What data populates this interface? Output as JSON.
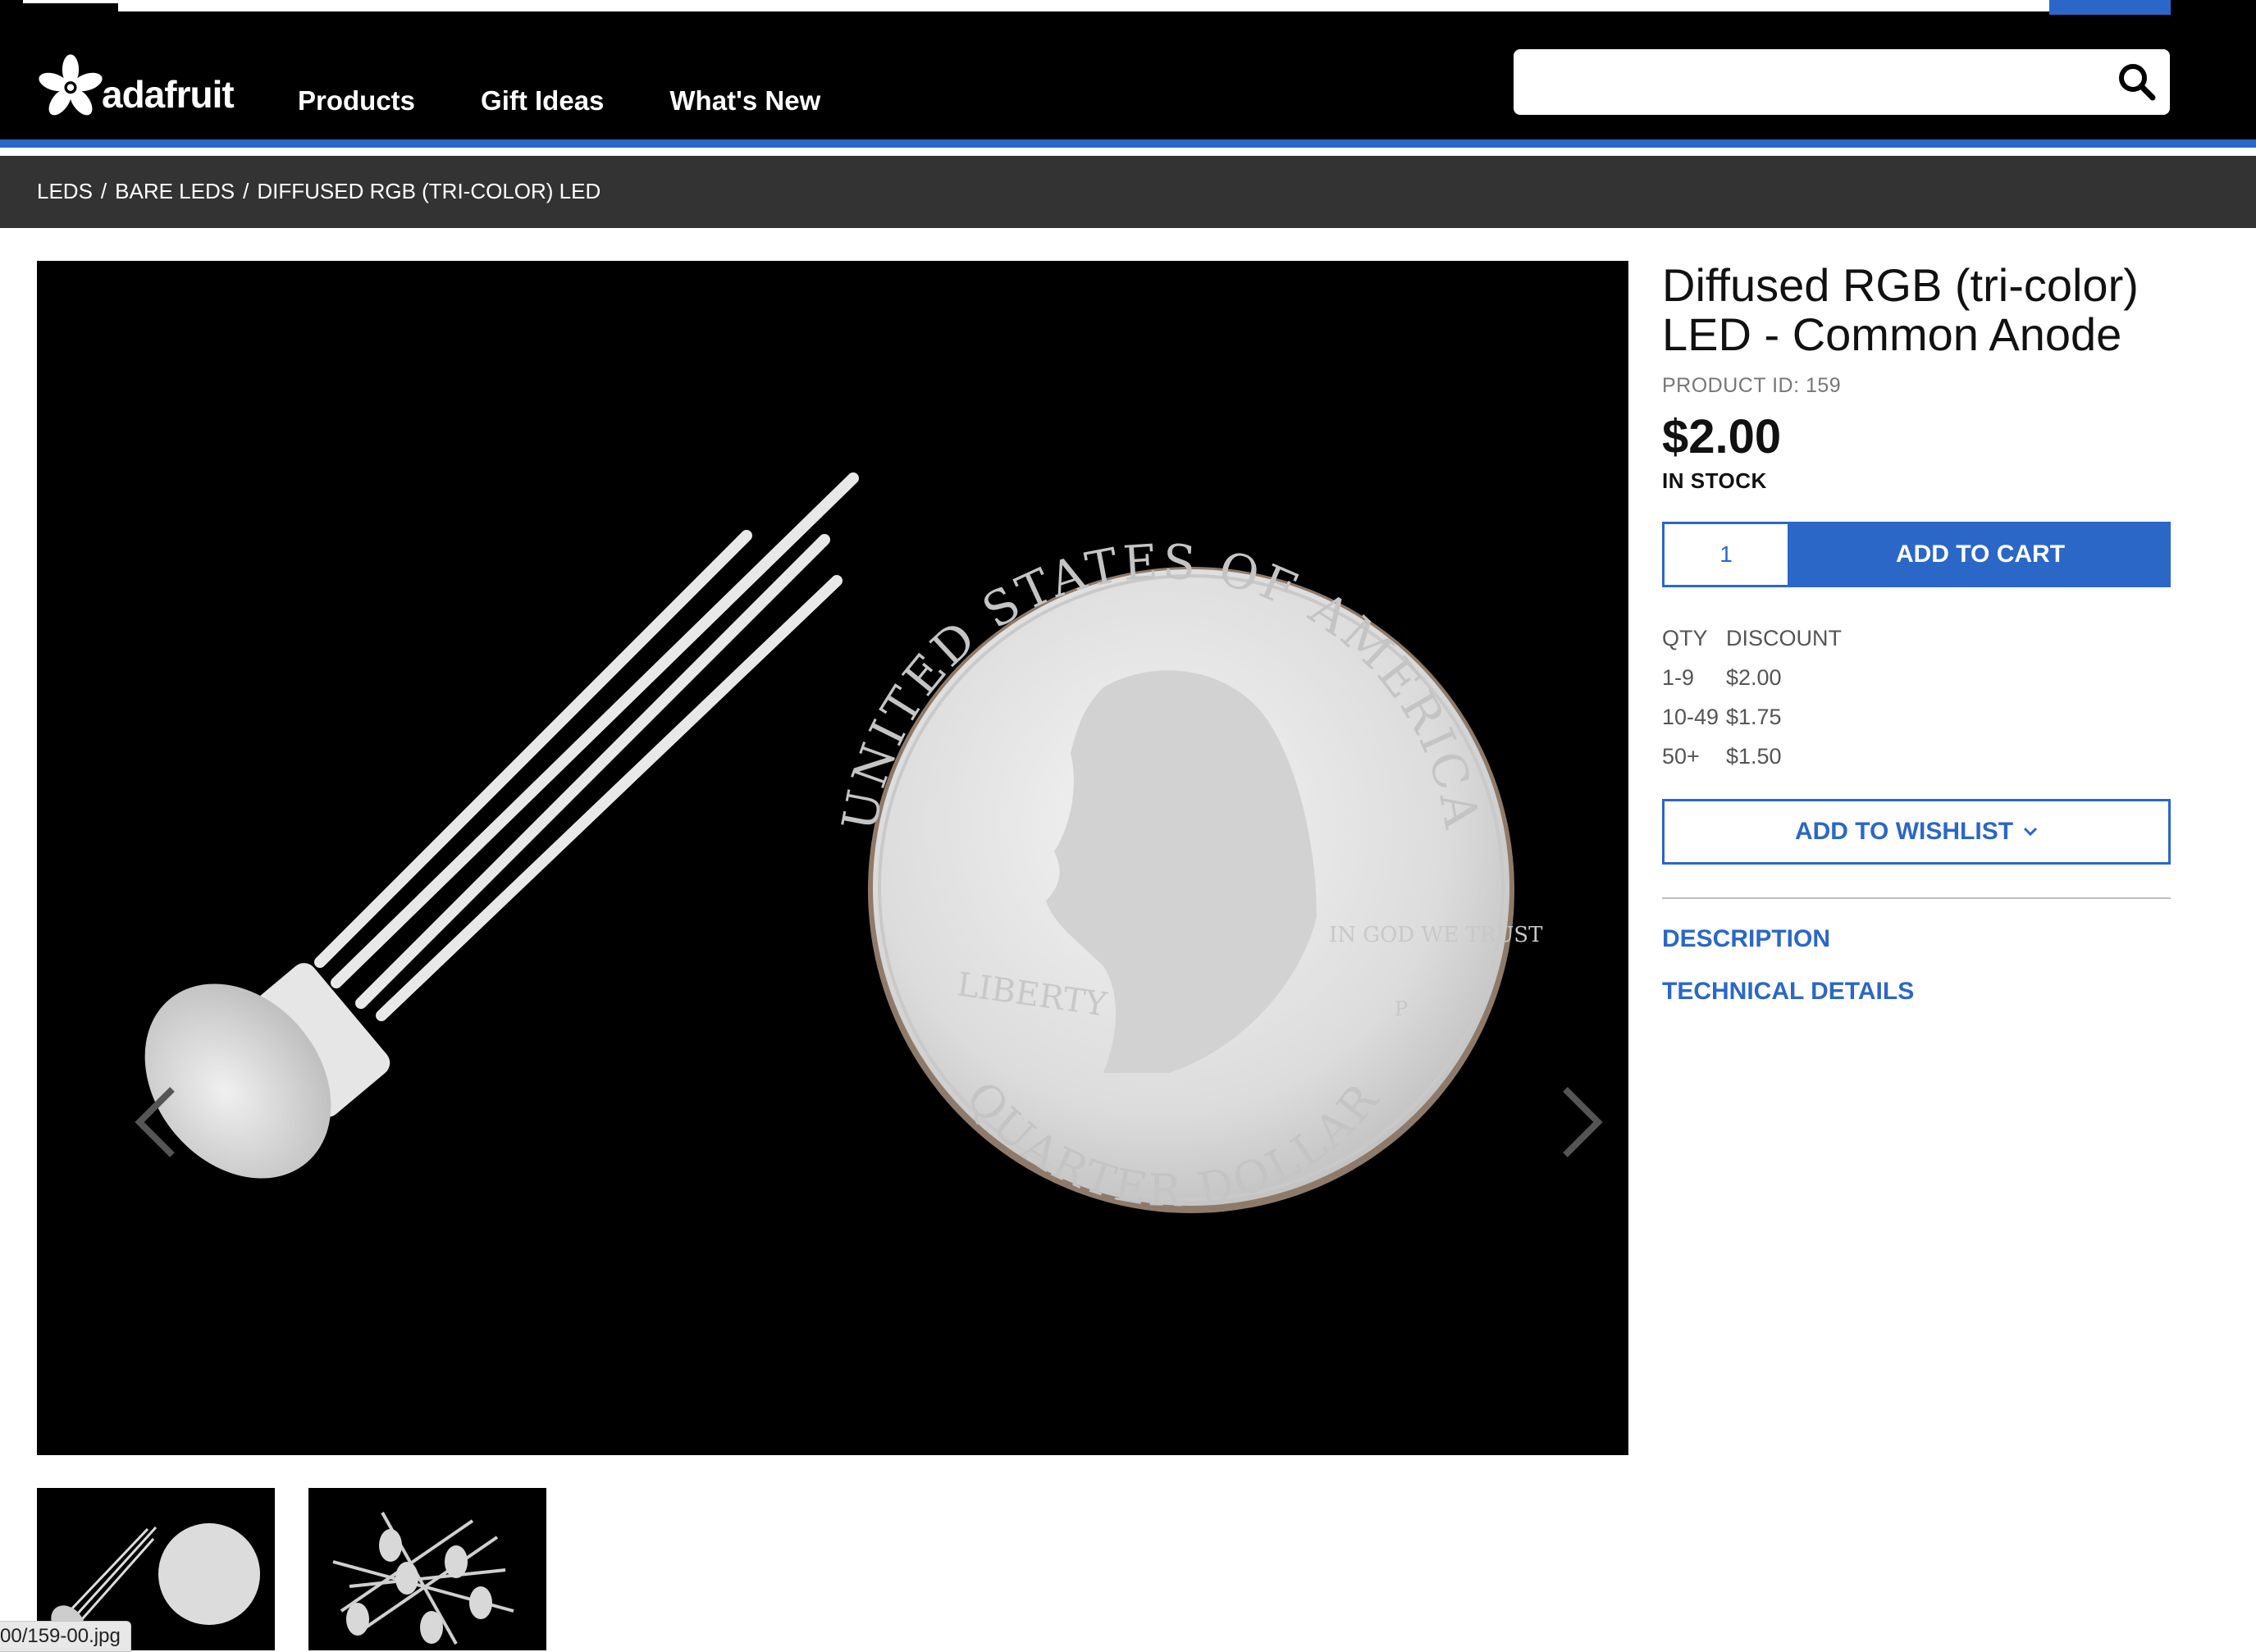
{
  "header": {
    "logo_text": "adafruit",
    "nav": [
      "Products",
      "Gift Ideas",
      "What's New"
    ],
    "search": {
      "value": "",
      "placeholder": ""
    }
  },
  "breadcrumb": [
    "LEDS",
    "BARE LEDS",
    "DIFFUSED RGB (TRI-COLOR) LED"
  ],
  "breadcrumb_separator": "/",
  "product": {
    "title": "Diffused RGB (tri-color) LED - Common Anode",
    "product_id": "PRODUCT ID: 159",
    "price": "$2.00",
    "stock": "IN STOCK",
    "quantity": "1",
    "add_to_cart": "ADD TO CART",
    "discount_headers": [
      "QTY",
      "DISCOUNT"
    ],
    "discounts": [
      {
        "qty": "1-9",
        "price": "$2.00"
      },
      {
        "qty": "10-49",
        "price": "$1.75"
      },
      {
        "qty": "50+",
        "price": "$1.50"
      }
    ],
    "add_to_wishlist": "ADD TO WISHLIST",
    "links": [
      "DESCRIPTION",
      "TECHNICAL DETAILS"
    ]
  },
  "gallery": {
    "coin_text_top": "UNITED STATES OF AMERICA",
    "coin_text_left": "LIBERTY",
    "coin_text_right": "IN GOD WE TRUST",
    "coin_text_bottom": "QUARTER DOLLAR",
    "mint_mark": "P"
  },
  "status_bar_text": "00/159-00.jpg",
  "colors": {
    "accent": "#2b67c6",
    "header_bg": "#000000",
    "breadcrumb_bg": "#333333"
  }
}
